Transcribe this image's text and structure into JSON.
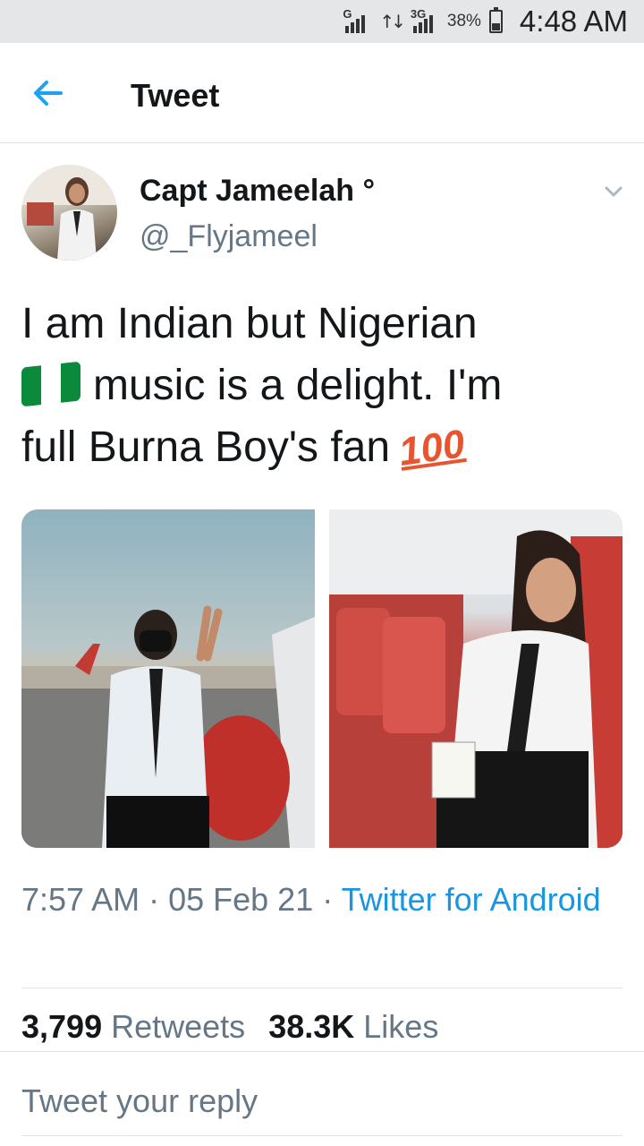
{
  "status_bar": {
    "signal1_label": "G",
    "signal2_label": "3G",
    "battery_percent_text": "38%",
    "battery_level": 0.38,
    "time": "4:48 AM"
  },
  "header": {
    "title": "Tweet",
    "back_icon": "arrow-left-icon",
    "accent_color": "#1da1f2"
  },
  "tweet": {
    "author": {
      "display_name": "Capt Jameelah °",
      "handle": "@_Flyjameel"
    },
    "text_part1": "I am Indian but Nigerian",
    "flag_emoji": "🇳🇬",
    "text_part2": "music is a delight. I'm",
    "text_part3": "full Burna Boy's fan",
    "hundred_emoji": "100",
    "media": [
      {
        "alt": "pilot-photo-1"
      },
      {
        "alt": "pilot-photo-2"
      }
    ],
    "time": "7:57 AM",
    "separator": " · ",
    "date": "05 Feb 21",
    "source": "Twitter for Android",
    "stats": {
      "retweets_count": "3,799",
      "retweets_label": "Retweets",
      "likes_count": "38.3K",
      "likes_label": "Likes"
    }
  },
  "reply": {
    "placeholder": "Tweet your reply"
  },
  "colors": {
    "link": "#1b95e0",
    "secondary_text": "#657786",
    "primary_text": "#14171a",
    "flag_green": "#0b8a3c"
  }
}
